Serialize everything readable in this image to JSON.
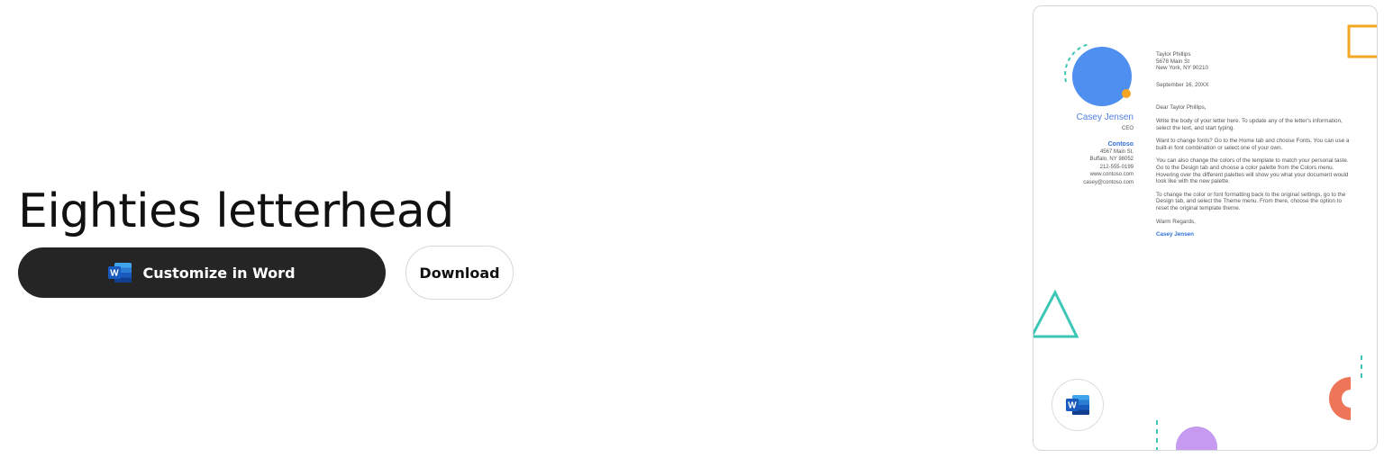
{
  "page": {
    "title": "Eighties letterhead",
    "customize_label": "Customize in Word",
    "download_label": "Download",
    "word_icon_letter": "W"
  },
  "letter": {
    "sender_name": "Casey Jensen",
    "sender_title": "CEO",
    "company": "Contoso",
    "address1": "4567 Main St.",
    "address2": "Buffalo, NY 98052",
    "phone": "212-555-0199",
    "website": "www.contoso.com",
    "email": "casey@contoso.com",
    "recipient_name": "Taylor Phillips",
    "recipient_address1": "5678 Main St",
    "recipient_address2": "New York, NY 90210",
    "date": "September 16, 20XX",
    "salutation": "Dear Taylor Phillips,",
    "para1": "Write the body of your letter here. To update any of the letter's information, select the text, and start typing.",
    "para2": "Want to change fonts? Go to the Home tab and choose Fonts. You can use a built-in font combination or select one of your own.",
    "para3": "You can also change the colors of the template to match your personal taste. Go to the Design tab and choose a color palette from the Colors menu. Hovering over the different palettes will show you what your document would look like with the new palette.",
    "para4": "To change the color or font formatting back to the original settings, go to the Design tab, and select the Theme menu. From there, choose the option to reset the original template theme.",
    "closing": "Warm Regards,",
    "signature": "Casey Jensen"
  },
  "colors": {
    "button_dark": "#252525",
    "accent_blue": "#4f8ff0",
    "accent_orange": "#f5a623",
    "accent_teal": "#3cc6b5",
    "accent_coral": "#ef7558",
    "accent_purple": "#c59af0",
    "word_blue": "#185abd"
  },
  "icons": [
    "word-icon"
  ]
}
